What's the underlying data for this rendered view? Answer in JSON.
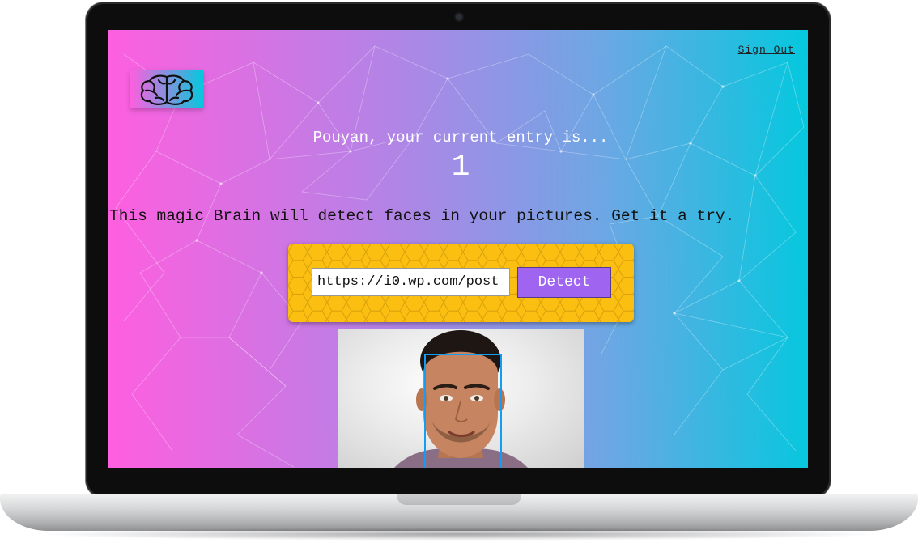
{
  "header": {
    "sign_out_label": "Sign Out"
  },
  "logo": {
    "icon": "brain-icon"
  },
  "rank": {
    "greeting": "Pouyan, your current entry is...",
    "count": "1"
  },
  "tagline": "This magic Brain will detect faces in your pictures. Get it a try.",
  "form": {
    "url_value": "https://i0.wp.com/post",
    "detect_label": "Detect"
  },
  "result": {
    "face_box_color": "#149df2"
  },
  "colors": {
    "gradient_start": "#ff5edf",
    "gradient_end": "#04c8de",
    "form_bg": "#fbbf12",
    "button_bg": "#9f64f0"
  }
}
